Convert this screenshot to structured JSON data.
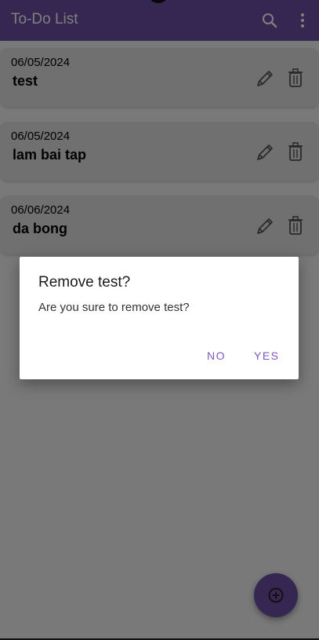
{
  "appbar": {
    "title": "To-Do List",
    "icons": [
      "search-icon",
      "more-vert-icon"
    ]
  },
  "todos": [
    {
      "date": "06/05/2024",
      "name": "test"
    },
    {
      "date": "06/05/2024",
      "name": "lam bai tap"
    },
    {
      "date": "06/06/2024",
      "name": "da bong"
    }
  ],
  "dialog": {
    "title": "Remove test?",
    "message": "Are you sure to remove test?",
    "no_label": "NO",
    "yes_label": "YES"
  },
  "fab": {
    "icon": "add-circle-icon"
  },
  "colors": {
    "primary": "#6a4fa3",
    "accent": "#7e57c2",
    "card": "#e0e0e0"
  }
}
